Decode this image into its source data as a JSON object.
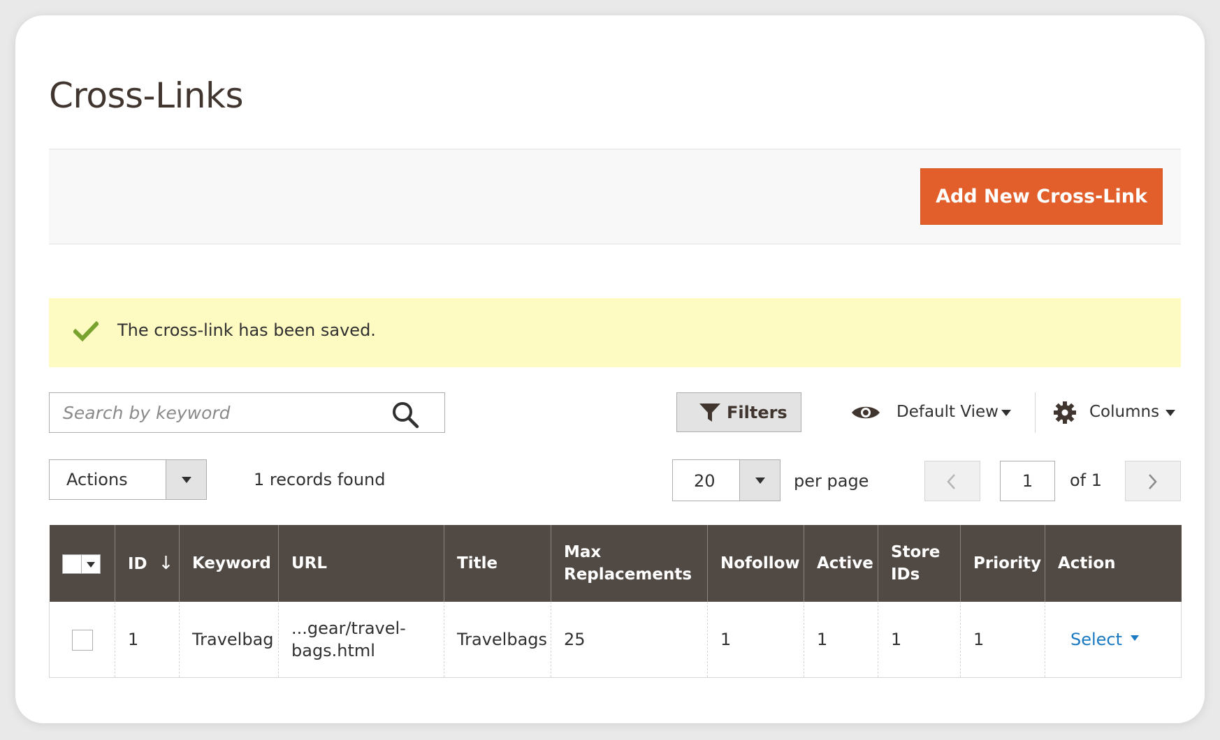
{
  "page": {
    "title": "Cross-Links"
  },
  "toolbar": {
    "add_button_label": "Add New Cross-Link"
  },
  "message": {
    "text": "The cross-link has been saved.",
    "type": "success"
  },
  "search": {
    "placeholder": "Search by keyword",
    "value": ""
  },
  "controls": {
    "filters_label": "Filters",
    "view_label": "Default View",
    "columns_label": "Columns"
  },
  "mass_actions": {
    "label": "Actions"
  },
  "records": {
    "text": "1 records found"
  },
  "pagination": {
    "per_page_value": "20",
    "per_page_label": "per page",
    "current_page": "1",
    "of_label": "of 1"
  },
  "grid": {
    "columns": [
      {
        "label": "ID"
      },
      {
        "label": "Keyword"
      },
      {
        "label": "URL"
      },
      {
        "label": "Title"
      },
      {
        "label": "Max Replacements"
      },
      {
        "label": "Nofollow"
      },
      {
        "label": "Active"
      },
      {
        "label": "Store IDs"
      },
      {
        "label": "Priority"
      },
      {
        "label": "Action"
      }
    ],
    "sort_indicator": "↓",
    "rows": [
      {
        "id": "1",
        "keyword": "Travelbag",
        "url": "...gear/travel-bags.html",
        "title": "Travelbags",
        "max_replacements": "25",
        "nofollow": "1",
        "active": "1",
        "store_ids": "1",
        "priority": "1",
        "action_label": "Select"
      }
    ]
  },
  "icons": {
    "message": "check-icon",
    "search": "search-icon",
    "filters": "funnel-icon",
    "view": "eye-icon",
    "columns": "gear-icon",
    "prev": "chevron-left-icon",
    "next": "chevron-right-icon"
  },
  "colors": {
    "accent": "#e25e2a",
    "header_bg": "#514943",
    "message_bg": "#fdfac2",
    "success": "#79a22e",
    "link": "#1979c3"
  }
}
